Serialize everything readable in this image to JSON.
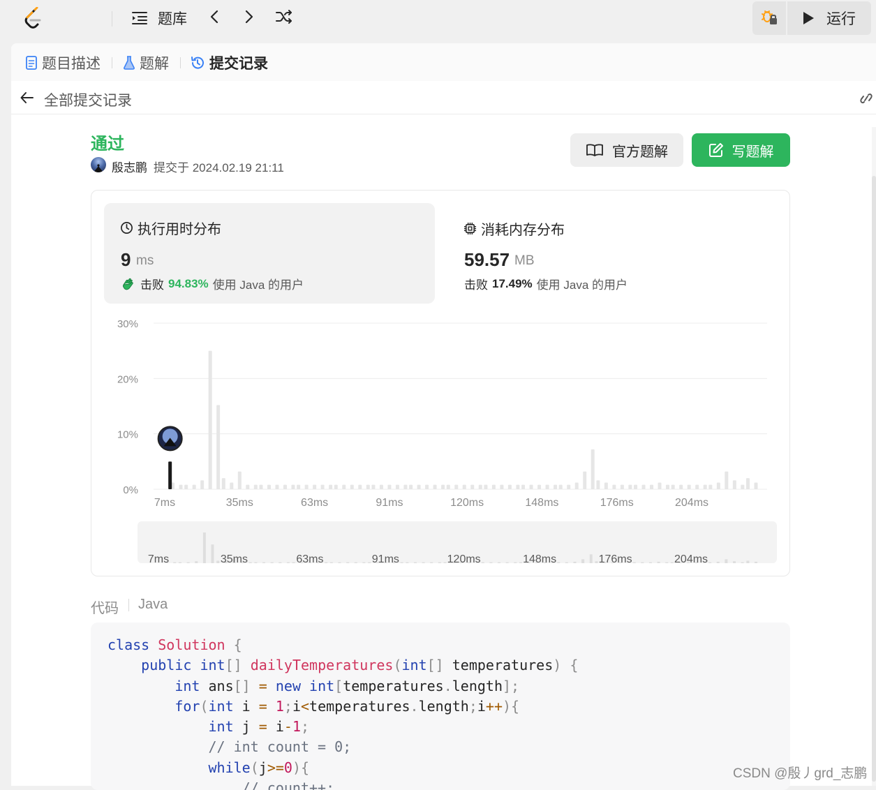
{
  "topbar": {
    "problem_bank_label": "题库",
    "run_label": "运行"
  },
  "tabs": {
    "description": "题目描述",
    "solutions": "题解",
    "submissions": "提交记录"
  },
  "subhead": {
    "title": "全部提交记录"
  },
  "submission": {
    "status": "通过",
    "submitter": "殷志鹏",
    "submitted_at": "提交于 2024.02.19 21:11",
    "official_solution_label": "官方题解",
    "write_solution_label": "写题解"
  },
  "runtime": {
    "title": "执行用时分布",
    "value": "9",
    "unit": "ms",
    "beat_prefix": "击败",
    "beat_pct": "94.83%",
    "beat_suffix": "使用 Java 的用户"
  },
  "memory": {
    "title": "消耗内存分布",
    "value": "59.57",
    "unit": "MB",
    "beat_prefix": "击败",
    "beat_pct": "17.49%",
    "beat_suffix": "使用 Java 的用户"
  },
  "chart_data": {
    "type": "bar",
    "title": "",
    "xlabel": "",
    "ylabel": "",
    "y_ticks": [
      "30%",
      "20%",
      "10%",
      "0%"
    ],
    "ylim": [
      0,
      30
    ],
    "x_ticks": [
      "7ms",
      "35ms",
      "63ms",
      "91ms",
      "120ms",
      "148ms",
      "176ms",
      "204ms"
    ],
    "your_value_ms": 9,
    "your_value_pct": 5,
    "bars": [
      {
        "x": 10,
        "pct": 1.2
      },
      {
        "x": 13,
        "pct": 0.8
      },
      {
        "x": 15,
        "pct": 0.8
      },
      {
        "x": 18,
        "pct": 0.8
      },
      {
        "x": 21,
        "pct": 1.6
      },
      {
        "x": 24,
        "pct": 25.0
      },
      {
        "x": 27,
        "pct": 15.2
      },
      {
        "x": 29,
        "pct": 2.0
      },
      {
        "x": 32,
        "pct": 1.2
      },
      {
        "x": 35,
        "pct": 3.2
      },
      {
        "x": 38,
        "pct": 0.8
      },
      {
        "x": 41,
        "pct": 0.8
      },
      {
        "x": 43,
        "pct": 0.8
      },
      {
        "x": 46,
        "pct": 0.8
      },
      {
        "x": 49,
        "pct": 0.8
      },
      {
        "x": 52,
        "pct": 0.8
      },
      {
        "x": 55,
        "pct": 0.8
      },
      {
        "x": 57,
        "pct": 0.8
      },
      {
        "x": 60,
        "pct": 0.8
      },
      {
        "x": 63,
        "pct": 0.8
      },
      {
        "x": 66,
        "pct": 0.8
      },
      {
        "x": 69,
        "pct": 0.8
      },
      {
        "x": 71,
        "pct": 0.8
      },
      {
        "x": 74,
        "pct": 0.8
      },
      {
        "x": 77,
        "pct": 0.8
      },
      {
        "x": 80,
        "pct": 0.8
      },
      {
        "x": 83,
        "pct": 0.8
      },
      {
        "x": 85,
        "pct": 0.8
      },
      {
        "x": 88,
        "pct": 0.8
      },
      {
        "x": 91,
        "pct": 0.8
      },
      {
        "x": 94,
        "pct": 0.8
      },
      {
        "x": 97,
        "pct": 0.8
      },
      {
        "x": 99,
        "pct": 0.8
      },
      {
        "x": 102,
        "pct": 0.8
      },
      {
        "x": 105,
        "pct": 0.8
      },
      {
        "x": 108,
        "pct": 0.8
      },
      {
        "x": 111,
        "pct": 0.8
      },
      {
        "x": 113,
        "pct": 0.8
      },
      {
        "x": 116,
        "pct": 0.8
      },
      {
        "x": 119,
        "pct": 0.8
      },
      {
        "x": 122,
        "pct": 0.8
      },
      {
        "x": 125,
        "pct": 0.8
      },
      {
        "x": 127,
        "pct": 0.8
      },
      {
        "x": 130,
        "pct": 0.8
      },
      {
        "x": 133,
        "pct": 0.8
      },
      {
        "x": 136,
        "pct": 0.8
      },
      {
        "x": 139,
        "pct": 0.8
      },
      {
        "x": 141,
        "pct": 0.8
      },
      {
        "x": 144,
        "pct": 0.8
      },
      {
        "x": 147,
        "pct": 0.8
      },
      {
        "x": 150,
        "pct": 0.8
      },
      {
        "x": 153,
        "pct": 0.8
      },
      {
        "x": 155,
        "pct": 0.8
      },
      {
        "x": 158,
        "pct": 0.8
      },
      {
        "x": 161,
        "pct": 1.2
      },
      {
        "x": 164,
        "pct": 3.2
      },
      {
        "x": 167,
        "pct": 7.2
      },
      {
        "x": 169,
        "pct": 1.6
      },
      {
        "x": 172,
        "pct": 1.2
      },
      {
        "x": 175,
        "pct": 0.8
      },
      {
        "x": 178,
        "pct": 0.8
      },
      {
        "x": 181,
        "pct": 0.8
      },
      {
        "x": 183,
        "pct": 0.8
      },
      {
        "x": 186,
        "pct": 0.8
      },
      {
        "x": 189,
        "pct": 0.8
      },
      {
        "x": 192,
        "pct": 1.2
      },
      {
        "x": 195,
        "pct": 0.8
      },
      {
        "x": 197,
        "pct": 0.8
      },
      {
        "x": 200,
        "pct": 0.8
      },
      {
        "x": 203,
        "pct": 0.8
      },
      {
        "x": 206,
        "pct": 0.8
      },
      {
        "x": 209,
        "pct": 0.8
      },
      {
        "x": 211,
        "pct": 0.8
      },
      {
        "x": 214,
        "pct": 1.2
      },
      {
        "x": 217,
        "pct": 3.2
      },
      {
        "x": 220,
        "pct": 1.6
      },
      {
        "x": 223,
        "pct": 0.8
      },
      {
        "x": 225,
        "pct": 2.0
      },
      {
        "x": 228,
        "pct": 1.2
      }
    ],
    "grid": true,
    "legend": "none"
  },
  "code": {
    "label": "代码",
    "language": "Java"
  },
  "watermark": "CSDN @殷丿grd_志鹏",
  "colors": {
    "accepted_green": "#2db55d",
    "keyword_blue": "#2342b0",
    "class_red": "#d0365e",
    "bar_gray": "#e6e6e6",
    "your_bar": "#1a1a1a"
  }
}
